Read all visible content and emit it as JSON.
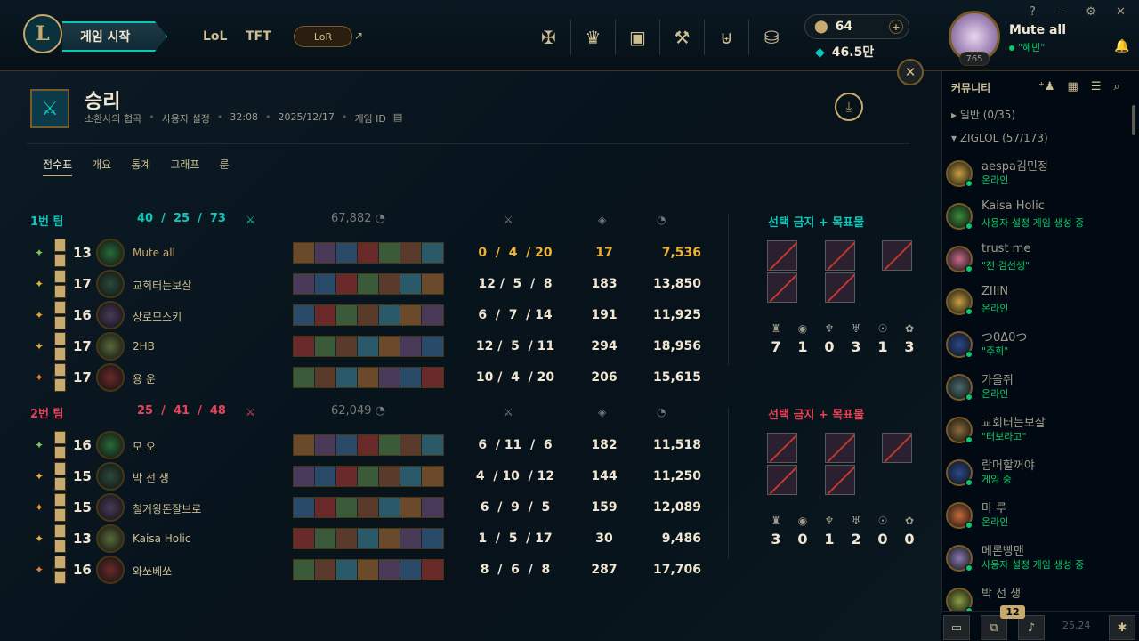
{
  "topbar": {
    "play_label": "게임 시작",
    "nav": [
      "LoL",
      "TFT"
    ],
    "lor_label": "LoR",
    "rp": "64",
    "be": "46.5만",
    "window_controls": [
      "?",
      "–",
      "⚙",
      "✕"
    ],
    "summoner": {
      "name": "Mute all",
      "status": "\"혜빈\"",
      "level": "765"
    }
  },
  "header": {
    "title": "승리",
    "meta": [
      "소환사의 협곡",
      "사용자 설정",
      "32:08",
      "2025/12/17",
      "게임 ID"
    ],
    "tabs": [
      "점수표",
      "개요",
      "통계",
      "그래프",
      "룬"
    ]
  },
  "team1": {
    "label": "1번 팀",
    "kda": "40  /  25  /  73",
    "gold": "67,882",
    "color": "#0ac8b9",
    "bans_title": "선택 금지 + 목표물",
    "objectives": [
      "7",
      "1",
      "0",
      "3",
      "1",
      "3"
    ],
    "players": [
      {
        "level": "13",
        "name": "Mute all",
        "kda": "0  /  4  / 20",
        "cs": "17",
        "gold": "7,536",
        "highlight": true
      },
      {
        "level": "17",
        "name": "교회터는보살",
        "kda": "12 /  5  /  8",
        "cs": "183",
        "gold": "13,850"
      },
      {
        "level": "16",
        "name": "상로므스키",
        "kda": "6  /  7  / 14",
        "cs": "191",
        "gold": "11,925"
      },
      {
        "level": "17",
        "name": "2HB",
        "kda": "12 /  5  / 11",
        "cs": "294",
        "gold": "18,956"
      },
      {
        "level": "17",
        "name": "용 운",
        "kda": "10 /  4  / 20",
        "cs": "206",
        "gold": "15,615"
      }
    ]
  },
  "team2": {
    "label": "2번 팀",
    "kda": "25  /  41  /  48",
    "gold": "62,049",
    "color": "#e84057",
    "bans_title": "선택 금지 + 목표물",
    "objectives": [
      "3",
      "0",
      "1",
      "2",
      "0",
      "0"
    ],
    "players": [
      {
        "level": "16",
        "name": "모 오",
        "kda": "6  / 11  /  6",
        "cs": "182",
        "gold": "11,518"
      },
      {
        "level": "15",
        "name": "박 선 생",
        "kda": "4  / 10  / 12",
        "cs": "144",
        "gold": "11,250"
      },
      {
        "level": "15",
        "name": "철거왕돈잘브로",
        "kda": "6  /  9  /  5",
        "cs": "159",
        "gold": "12,089"
      },
      {
        "level": "13",
        "name": "Kaisa Holic",
        "kda": "1  /  5  / 17",
        "cs": "30",
        "gold": "9,486"
      },
      {
        "level": "16",
        "name": "와쏘베쏘",
        "kda": "8  /  6  /  8",
        "cs": "287",
        "gold": "17,706"
      }
    ]
  },
  "sidebar": {
    "title": "커뮤니티",
    "groups": [
      "▸ 일반 (0/35)",
      "▾ ZIGLOL (57/173)"
    ],
    "friends": [
      {
        "name": "aespa김민정",
        "status": "온라인",
        "color": "#0acb6b"
      },
      {
        "name": "Kaisa Holic",
        "status": "사용자 설정 게임 생성 중",
        "color": "#0acb6b"
      },
      {
        "name": "trust me",
        "status": "\"전 검선생\"",
        "color": "#0acb6b"
      },
      {
        "name": "ZIIIN",
        "status": "온라인",
        "color": "#0acb6b"
      },
      {
        "name": "つ0Δ0つ",
        "status": "\"주희\"",
        "color": "#0acb6b"
      },
      {
        "name": "가을쥐",
        "status": "온라인",
        "color": "#0acb6b"
      },
      {
        "name": "교회터는보살",
        "status": "\"터보라고\"",
        "color": "#0acb6b"
      },
      {
        "name": "람머할꺼야",
        "status": "게임 중",
        "color": "#0acb6b"
      },
      {
        "name": "마 루",
        "status": "온라인",
        "color": "#0acb6b"
      },
      {
        "name": "메론빵맨",
        "status": "사용자 설정 게임 생성 중",
        "color": "#0acb6b"
      },
      {
        "name": "박 선 생",
        "status": "",
        "color": "#0acb6b"
      }
    ],
    "badge": "12",
    "version": "25.24"
  }
}
